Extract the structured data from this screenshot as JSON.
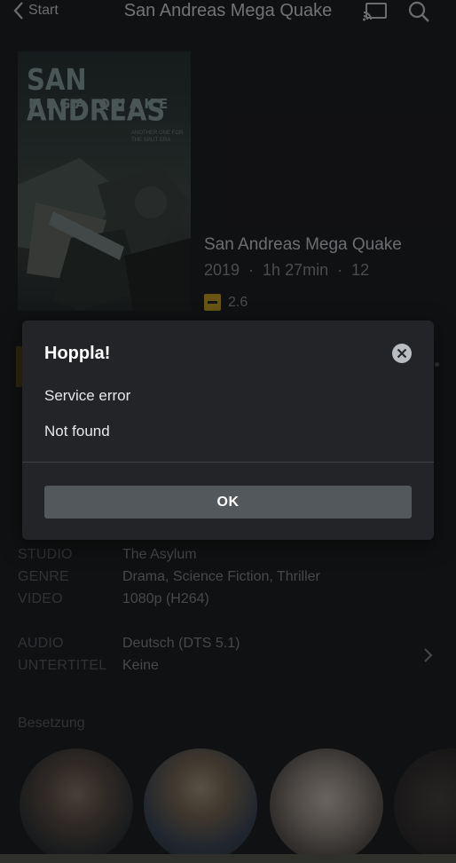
{
  "nav": {
    "back_label": "Start",
    "title": "San Andreas Mega Quake",
    "cast_icon": "cast-icon",
    "search_icon": "search-icon"
  },
  "poster": {
    "title_line1": "SAN ANDREAS",
    "title_line2": "MEGA QUAKE",
    "tagline": "ANOTHER ONE FOR THE SPLIT ERA"
  },
  "details": {
    "title": "San Andreas Mega Quake",
    "year": "2019",
    "duration": "1h 27min",
    "age_rating": "12",
    "rating_icon": "imdb-badge-icon",
    "rating_value": "2.6"
  },
  "info": [
    {
      "label": "STUDIO",
      "value": "The Asylum"
    },
    {
      "label": "GENRE",
      "value": "Drama, Science Fiction, Thriller"
    },
    {
      "label": "VIDEO",
      "value": "1080p (H264)"
    },
    {
      "label": "AUDIO",
      "value": "Deutsch (DTS 5.1)"
    },
    {
      "label": "UNTERTITEL",
      "value": "Keine"
    }
  ],
  "cast_section": {
    "title": "Besetzung"
  },
  "dialog": {
    "title": "Hoppla!",
    "message_line1": "Service error",
    "message_line2": "Not found",
    "ok_label": "OK",
    "close_icon": "close-icon"
  },
  "colors": {
    "background": "#202124",
    "dialog_bg": "#222427",
    "button_bg": "#53585c",
    "accent_rating": "#c9a227"
  }
}
